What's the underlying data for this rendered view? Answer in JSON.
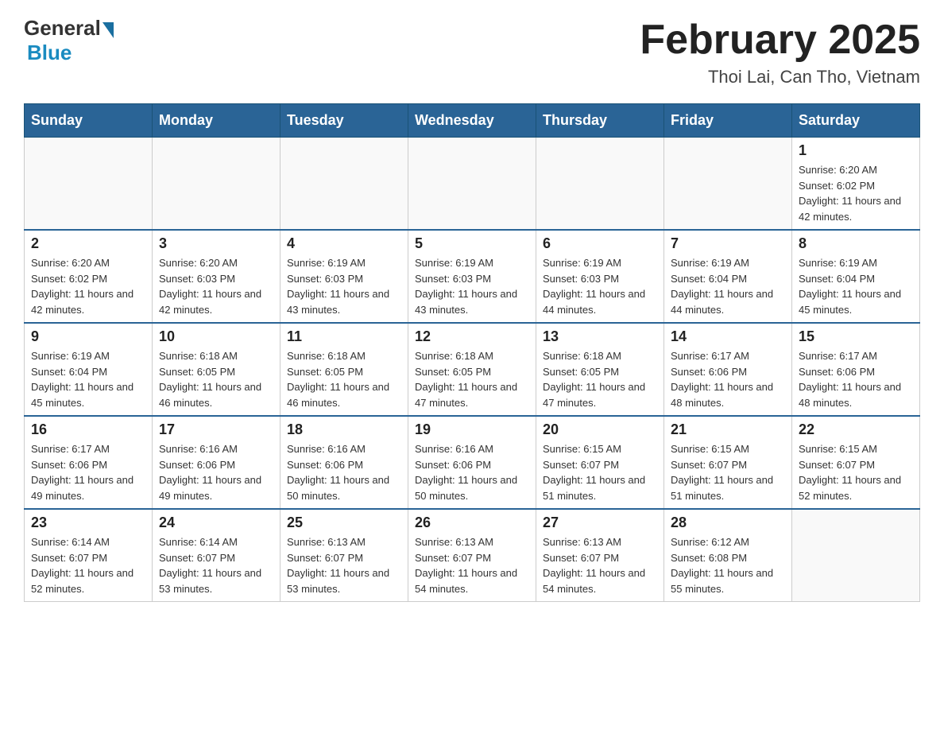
{
  "logo": {
    "general": "General",
    "blue": "Blue"
  },
  "title": {
    "month_year": "February 2025",
    "location": "Thoi Lai, Can Tho, Vietnam"
  },
  "days_of_week": [
    "Sunday",
    "Monday",
    "Tuesday",
    "Wednesday",
    "Thursday",
    "Friday",
    "Saturday"
  ],
  "weeks": [
    [
      {
        "day": "",
        "info": ""
      },
      {
        "day": "",
        "info": ""
      },
      {
        "day": "",
        "info": ""
      },
      {
        "day": "",
        "info": ""
      },
      {
        "day": "",
        "info": ""
      },
      {
        "day": "",
        "info": ""
      },
      {
        "day": "1",
        "info": "Sunrise: 6:20 AM\nSunset: 6:02 PM\nDaylight: 11 hours and 42 minutes."
      }
    ],
    [
      {
        "day": "2",
        "info": "Sunrise: 6:20 AM\nSunset: 6:02 PM\nDaylight: 11 hours and 42 minutes."
      },
      {
        "day": "3",
        "info": "Sunrise: 6:20 AM\nSunset: 6:03 PM\nDaylight: 11 hours and 42 minutes."
      },
      {
        "day": "4",
        "info": "Sunrise: 6:19 AM\nSunset: 6:03 PM\nDaylight: 11 hours and 43 minutes."
      },
      {
        "day": "5",
        "info": "Sunrise: 6:19 AM\nSunset: 6:03 PM\nDaylight: 11 hours and 43 minutes."
      },
      {
        "day": "6",
        "info": "Sunrise: 6:19 AM\nSunset: 6:03 PM\nDaylight: 11 hours and 44 minutes."
      },
      {
        "day": "7",
        "info": "Sunrise: 6:19 AM\nSunset: 6:04 PM\nDaylight: 11 hours and 44 minutes."
      },
      {
        "day": "8",
        "info": "Sunrise: 6:19 AM\nSunset: 6:04 PM\nDaylight: 11 hours and 45 minutes."
      }
    ],
    [
      {
        "day": "9",
        "info": "Sunrise: 6:19 AM\nSunset: 6:04 PM\nDaylight: 11 hours and 45 minutes."
      },
      {
        "day": "10",
        "info": "Sunrise: 6:18 AM\nSunset: 6:05 PM\nDaylight: 11 hours and 46 minutes."
      },
      {
        "day": "11",
        "info": "Sunrise: 6:18 AM\nSunset: 6:05 PM\nDaylight: 11 hours and 46 minutes."
      },
      {
        "day": "12",
        "info": "Sunrise: 6:18 AM\nSunset: 6:05 PM\nDaylight: 11 hours and 47 minutes."
      },
      {
        "day": "13",
        "info": "Sunrise: 6:18 AM\nSunset: 6:05 PM\nDaylight: 11 hours and 47 minutes."
      },
      {
        "day": "14",
        "info": "Sunrise: 6:17 AM\nSunset: 6:06 PM\nDaylight: 11 hours and 48 minutes."
      },
      {
        "day": "15",
        "info": "Sunrise: 6:17 AM\nSunset: 6:06 PM\nDaylight: 11 hours and 48 minutes."
      }
    ],
    [
      {
        "day": "16",
        "info": "Sunrise: 6:17 AM\nSunset: 6:06 PM\nDaylight: 11 hours and 49 minutes."
      },
      {
        "day": "17",
        "info": "Sunrise: 6:16 AM\nSunset: 6:06 PM\nDaylight: 11 hours and 49 minutes."
      },
      {
        "day": "18",
        "info": "Sunrise: 6:16 AM\nSunset: 6:06 PM\nDaylight: 11 hours and 50 minutes."
      },
      {
        "day": "19",
        "info": "Sunrise: 6:16 AM\nSunset: 6:06 PM\nDaylight: 11 hours and 50 minutes."
      },
      {
        "day": "20",
        "info": "Sunrise: 6:15 AM\nSunset: 6:07 PM\nDaylight: 11 hours and 51 minutes."
      },
      {
        "day": "21",
        "info": "Sunrise: 6:15 AM\nSunset: 6:07 PM\nDaylight: 11 hours and 51 minutes."
      },
      {
        "day": "22",
        "info": "Sunrise: 6:15 AM\nSunset: 6:07 PM\nDaylight: 11 hours and 52 minutes."
      }
    ],
    [
      {
        "day": "23",
        "info": "Sunrise: 6:14 AM\nSunset: 6:07 PM\nDaylight: 11 hours and 52 minutes."
      },
      {
        "day": "24",
        "info": "Sunrise: 6:14 AM\nSunset: 6:07 PM\nDaylight: 11 hours and 53 minutes."
      },
      {
        "day": "25",
        "info": "Sunrise: 6:13 AM\nSunset: 6:07 PM\nDaylight: 11 hours and 53 minutes."
      },
      {
        "day": "26",
        "info": "Sunrise: 6:13 AM\nSunset: 6:07 PM\nDaylight: 11 hours and 54 minutes."
      },
      {
        "day": "27",
        "info": "Sunrise: 6:13 AM\nSunset: 6:07 PM\nDaylight: 11 hours and 54 minutes."
      },
      {
        "day": "28",
        "info": "Sunrise: 6:12 AM\nSunset: 6:08 PM\nDaylight: 11 hours and 55 minutes."
      },
      {
        "day": "",
        "info": ""
      }
    ]
  ]
}
